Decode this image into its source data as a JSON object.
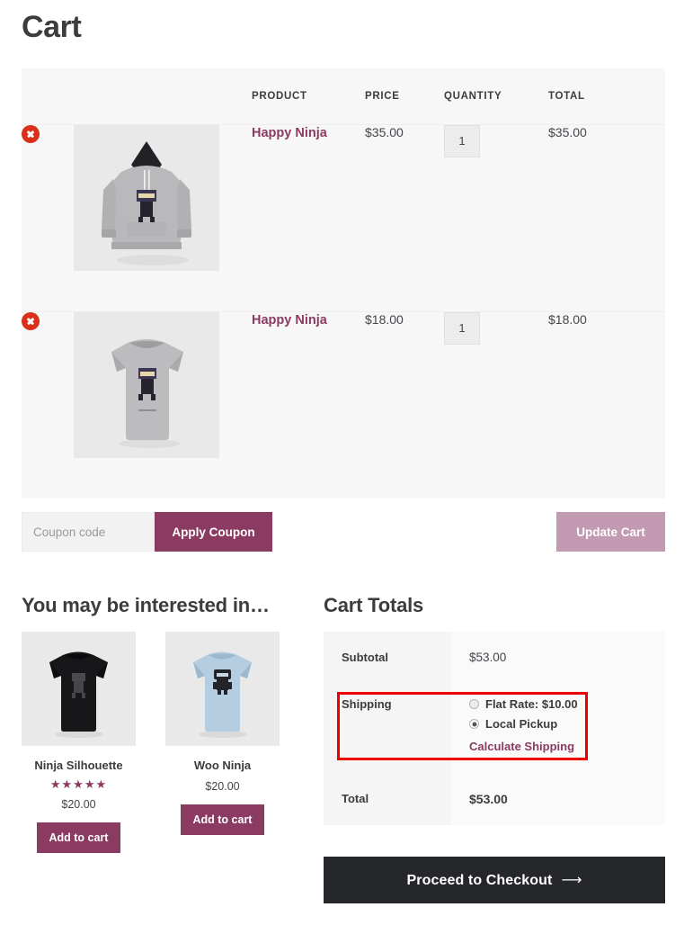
{
  "page": {
    "title": "Cart"
  },
  "cart_table": {
    "headers": {
      "remove": "",
      "thumbnail": "",
      "product": "PRODUCT",
      "price": "PRICE",
      "quantity": "QUANTITY",
      "total": "TOTAL"
    },
    "rows": [
      {
        "remove_icon": "remove-circle-icon",
        "thumbnail_icon": "gray-hoodie-product-image",
        "product": "Happy Ninja",
        "price": "$35.00",
        "quantity": "1",
        "total": "$35.00"
      },
      {
        "remove_icon": "remove-circle-icon",
        "thumbnail_icon": "gray-tshirt-product-image",
        "product": "Happy Ninja",
        "price": "$18.00",
        "quantity": "1",
        "total": "$18.00"
      }
    ]
  },
  "actions": {
    "coupon_placeholder": "Coupon code",
    "coupon_value": "",
    "apply_coupon_label": "Apply Coupon",
    "update_cart_label": "Update Cart"
  },
  "upsells": {
    "heading": "You may be interested in…",
    "items": [
      {
        "title": "Ninja Silhouette",
        "thumbnail_icon": "black-tshirt-product-image",
        "rating_stars": "★★★★★",
        "rating_value": 5,
        "price": "$20.00",
        "add_label": "Add to cart"
      },
      {
        "title": "Woo Ninja",
        "thumbnail_icon": "blue-tshirt-product-image",
        "rating_stars": "",
        "rating_value": null,
        "price": "$20.00",
        "add_label": "Add to cart"
      }
    ]
  },
  "cart_totals": {
    "heading": "Cart Totals",
    "subtotal_label": "Subtotal",
    "subtotal_value": "$53.00",
    "shipping_label": "Shipping",
    "shipping_options": [
      {
        "label": "Flat Rate: $10.00",
        "selected": false
      },
      {
        "label": "Local Pickup",
        "selected": true
      }
    ],
    "calculate_shipping_label": "Calculate Shipping",
    "total_label": "Total",
    "total_value": "$53.00"
  },
  "checkout": {
    "label": "Proceed to Checkout",
    "arrow": "⟶"
  },
  "annotation": {
    "highlight_color": "#ee0000",
    "target": "shipping-row"
  },
  "colors": {
    "accent_purple": "#8b3a62",
    "muted_purple": "#c29bb3",
    "remove_red": "#d8301a",
    "checkout_dark": "#26272b",
    "table_bg": "#f7f7f7",
    "totals_label_bg": "#f5f5f5",
    "totals_value_bg": "#fafafa"
  }
}
